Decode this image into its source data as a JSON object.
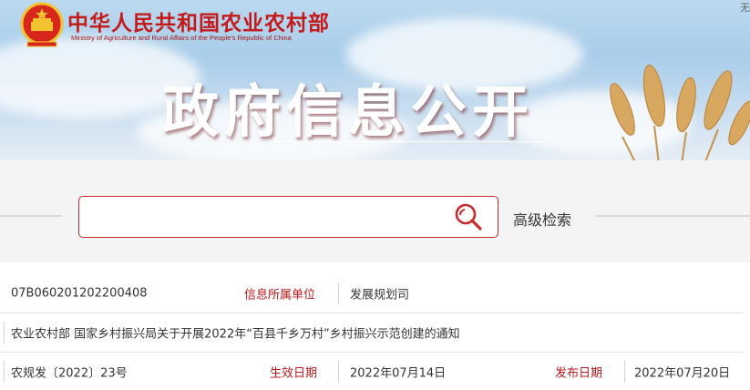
{
  "header": {
    "site_title": "中华人民共和国农业农村部",
    "site_subtitle": "Ministry of Agriculture and Rural Affairs of the People's Republic of China",
    "corner_text": "无",
    "page_title": "政府信息公开"
  },
  "search": {
    "placeholder": "",
    "value": "",
    "advanced_label": "高级检索"
  },
  "info": {
    "index_no": "07B060201202200408",
    "unit_label": "信息所属单位",
    "unit_value": "发展规划司",
    "doc_title": "农业农村部 国家乡村振兴局关于开展2022年“百县千乡万村”乡村振兴示范创建的通知",
    "doc_no": "农规发〔2022〕23号",
    "effective_label": "生效日期",
    "effective_value": "2022年07月14日",
    "publish_label": "发布日期",
    "publish_value": "2022年07月20日"
  },
  "colors": {
    "brand_red": "#c41a1a",
    "label_red": "#b3191d",
    "search_border": "#c62c2c"
  },
  "icons": {
    "emblem": "national-emblem-icon",
    "search": "search-icon"
  }
}
